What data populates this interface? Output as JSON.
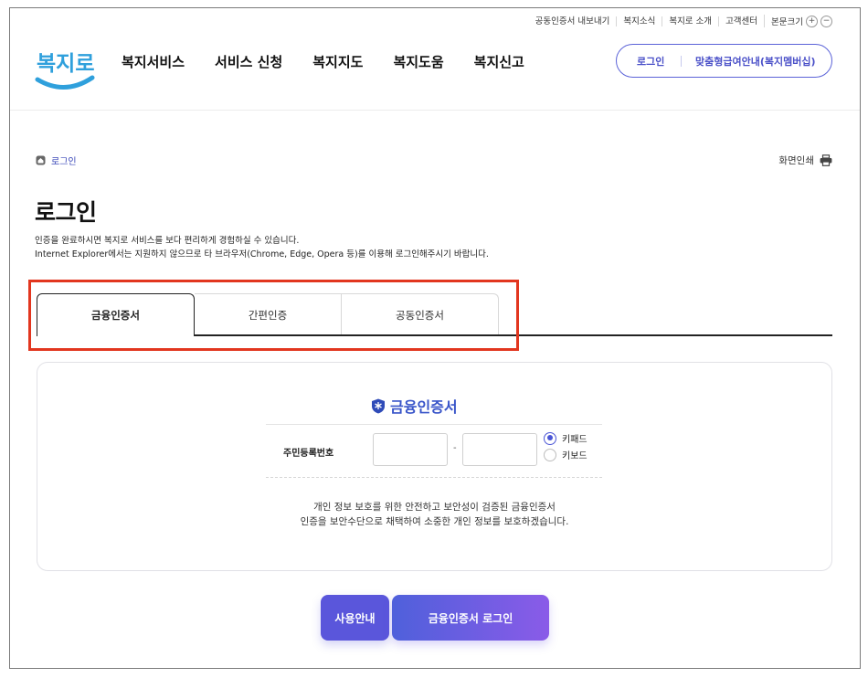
{
  "utility_nav": {
    "items": [
      "공동인증서 내보내기",
      "복지소식",
      "복지로 소개",
      "고객센터"
    ],
    "font_size_label": "본문크기",
    "zoom_in": "+",
    "zoom_out": "−"
  },
  "header": {
    "logo_text": "복지로",
    "menu": [
      "복지서비스",
      "서비스 신청",
      "복지지도",
      "복지도움",
      "복지신고"
    ],
    "login_label": "로그인",
    "membership_label": "맞춤형급여안내(복지멤버십)"
  },
  "breadcrumb": {
    "label": "로그인"
  },
  "print_label": "화면인쇄",
  "page": {
    "title": "로그인",
    "desc_line1": "인증을 완료하시면 복지로 서비스를 보다 편리하게 경험하실 수 있습니다.",
    "desc_line2": "Internet Explorer에서는 지원하지 않으므로 타 브라우저(Chrome, Edge, Opera 등)를 이용해 로그인해주시기 바랍니다."
  },
  "tabs": [
    {
      "label": "금융인증서",
      "selected": true
    },
    {
      "label": "간편인증",
      "selected": false
    },
    {
      "label": "공동인증서",
      "selected": false
    }
  ],
  "panel": {
    "title": "금융인증서",
    "rrn_label": "주민등록번호",
    "rrn_front_value": "",
    "rrn_back_value": "",
    "dash": "-",
    "input_mode_options": [
      "키패드",
      "키보드"
    ],
    "input_mode_selected": "키패드",
    "note_line1": "개인 정보 보호를 위한 안전하고 보안성이 검증된 금융인증서",
    "note_line2": "인증을 보안수단으로 채택하여 소중한 개인 정보를 보호하겠습니다."
  },
  "buttons": {
    "guide": "사용안내",
    "login": "금융인증서 로그인"
  },
  "colors": {
    "brand_blue": "#4a50c8",
    "highlight_red": "#e2361f",
    "panel_title_blue": "#3955c9"
  }
}
